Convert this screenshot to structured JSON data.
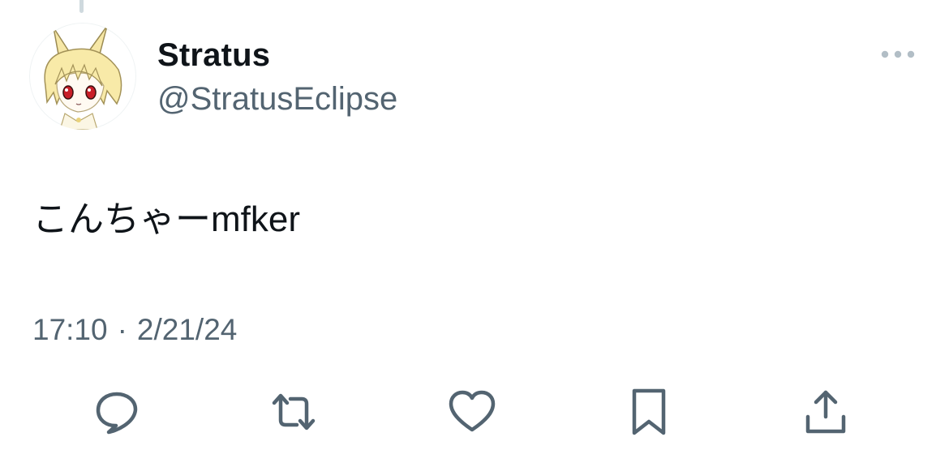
{
  "tweet": {
    "author": {
      "display_name": "Stratus",
      "handle": "@StratusEclipse",
      "avatar_icon": "anime-avatar-icon"
    },
    "text": "こんちゃーmfker",
    "timestamp": {
      "time": "17:10",
      "separator": "·",
      "date": "2/21/24"
    }
  },
  "actions": [
    {
      "name": "reply",
      "icon": "reply-icon"
    },
    {
      "name": "retweet",
      "icon": "retweet-icon"
    },
    {
      "name": "like",
      "icon": "heart-icon"
    },
    {
      "name": "bookmark",
      "icon": "bookmark-icon"
    },
    {
      "name": "share",
      "icon": "share-icon"
    }
  ],
  "colors": {
    "primary_text": "#0f1419",
    "secondary_text": "#536471",
    "icon": "#536471",
    "thread_line": "#cfd9de"
  }
}
